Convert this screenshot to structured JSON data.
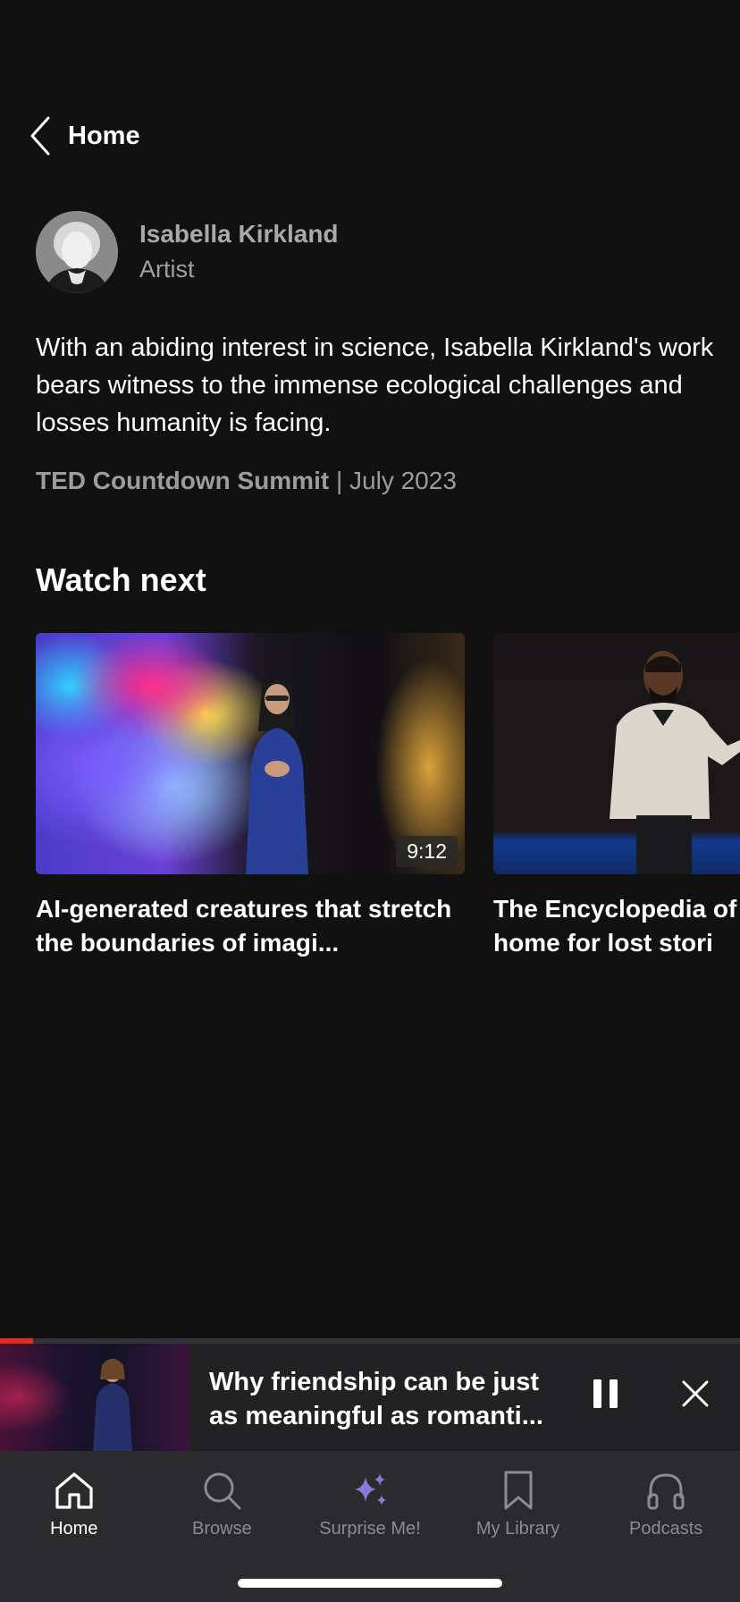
{
  "nav": {
    "back_label": "Home"
  },
  "speaker": {
    "name": "Isabella Kirkland",
    "role": "Artist"
  },
  "description": "With an abiding interest in science, Isabella Kirkland's work bears witness to the immense ecological challenges and losses humanity is facing.",
  "event": {
    "name": "TED Countdown Summit",
    "separator": " | ",
    "date": "July 2023"
  },
  "watch_next": {
    "title": "Watch next",
    "cards": [
      {
        "title": "AI-generated creatures that stretch the boundaries of imagi...",
        "duration": "9:12"
      },
      {
        "title": "The Encyclopedia of a home for lost stori"
      }
    ]
  },
  "mini_player": {
    "title": "Why friendship can be just as meaningful as romanti...",
    "progress": 0.045,
    "accent": "#e62b1e"
  },
  "tabs": [
    {
      "label": "Home",
      "icon": "home-icon",
      "active": true
    },
    {
      "label": "Browse",
      "icon": "search-icon",
      "active": false
    },
    {
      "label": "Surprise Me!",
      "icon": "sparkle-icon",
      "active": false
    },
    {
      "label": "My Library",
      "icon": "bookmark-icon",
      "active": false
    },
    {
      "label": "Podcasts",
      "icon": "headphones-icon",
      "active": false
    }
  ],
  "colors": {
    "background": "#111112",
    "tabbar": "#2b2b2e",
    "sparkle": "#8a7ad8"
  }
}
